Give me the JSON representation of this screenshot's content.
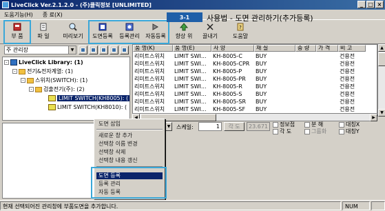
{
  "window": {
    "title": "LiveClick Ver.2.1.2.0 - (주)클릭정보 [UNLIMITED]"
  },
  "menubar": [
    "도움기능(H)",
    "종  료(X)"
  ],
  "toolbar": {
    "parts": "부  품",
    "file": "파  일",
    "preview": "미리보기",
    "drawing_register": "도면등록",
    "register_manage": "등록관리",
    "auto_register": "자동등록",
    "up": "향상 위",
    "hide_all": "끌내기",
    "help": "도움말"
  },
  "callout": {
    "tag": "3-1",
    "title": "사용법 - 도면 관리하기(추가등록)"
  },
  "left_panel": {
    "combo": "주 관리장"
  },
  "tree": [
    {
      "label": "LiveClick Library: (1)",
      "bold": true
    },
    {
      "label": "전기&전자계열: (1)"
    },
    {
      "label": "스위치(SWITCH): (1)"
    },
    {
      "label": "검출전기(주): (2)"
    },
    {
      "label": "LIMIT SWITCH(KH8005): (",
      "selected": true
    },
    {
      "label": "LIMIT SWITCH(KH8010): ("
    }
  ],
  "table": {
    "headers": [
      "품  명(K)",
      "품  명(E)",
      "사  양",
      "재  질",
      "중  량",
      "가  격",
      "비  고"
    ],
    "rows": [
      [
        "리미트스위치",
        "LIMIT SWI...",
        "KH-8005-C",
        "BUY",
        "",
        "",
        "건용전"
      ],
      [
        "리미트스위치",
        "LIMIT SWI...",
        "KH-8005-CPR",
        "BUY",
        "",
        "",
        "건용전"
      ],
      [
        "리미트스위치",
        "LIMIT SWI...",
        "KH-8005-P",
        "BUY",
        "",
        "",
        "건용전"
      ],
      [
        "리미트스위치",
        "LIMIT SWI...",
        "KH-8005-PR",
        "BUY",
        "",
        "",
        "건용전"
      ],
      [
        "리미트스위치",
        "LIMIT SWI...",
        "KH-8005-R",
        "BUY",
        "",
        "",
        "건용전"
      ],
      [
        "리미트스위치",
        "LIMIT SWI...",
        "KH-8005-S",
        "BUY",
        "",
        "",
        "건용전"
      ],
      [
        "리미트스위치",
        "LIMIT SWI...",
        "KH-8005-SR",
        "BUY",
        "",
        "",
        "건용전"
      ],
      [
        "리미트스위치",
        "LIMIT SWI...",
        "KH-8005-SF",
        "BUY",
        "",
        "",
        "건용전"
      ]
    ]
  },
  "scale": {
    "label": "스케일:",
    "value": "1",
    "angle_btn": "각  도",
    "angle_val": "23.671"
  },
  "checkboxes": {
    "c1": "정보접",
    "c2": "분   해",
    "c3": "대칭X",
    "c4": "각   도",
    "c5": "그룹화",
    "c6": "대칭Y"
  },
  "context_menu": {
    "insert": "도면 삽입",
    "new_tab": "새로운 창 추가",
    "rename": "선택창 이름 변경",
    "delete": "선택창 삭제",
    "refresh": "선택창 내용 갱신",
    "register": "도면 등록",
    "manage": "등록 관리",
    "auto": "자동 등록"
  },
  "status": {
    "text": "현재 선택되어진 관리창에 부품도면을 추가합니다.",
    "num": "NUM"
  }
}
